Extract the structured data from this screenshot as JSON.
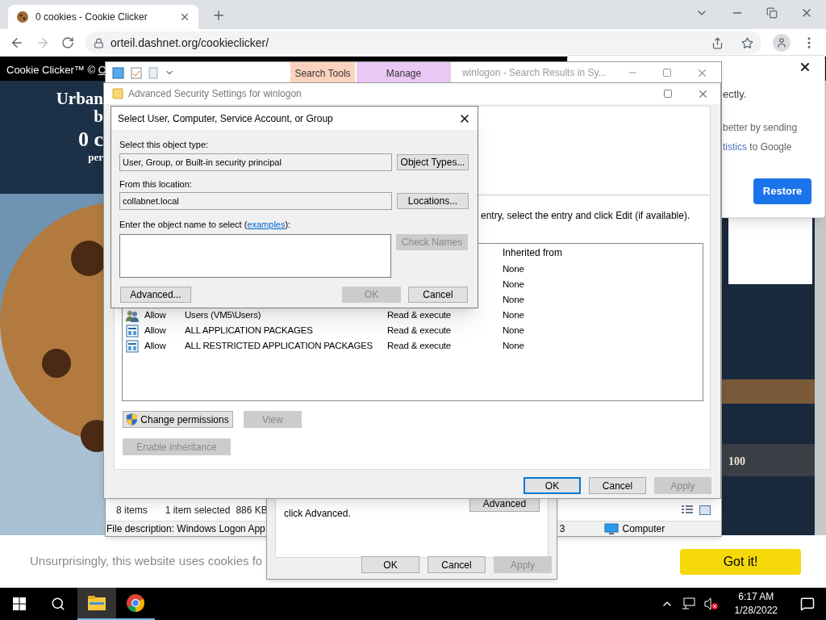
{
  "browser": {
    "tab_title": "0 cookies - Cookie Clicker",
    "url": "orteil.dashnet.org/cookieclicker/"
  },
  "page": {
    "header": "Cookie Clicker™ ©",
    "header_link": "O",
    "bakery_name": [
      "Urban",
      "b"
    ],
    "cookie_count": "0 c",
    "per_second": "per",
    "right_count": "100",
    "cookie_notice": {
      "text": "Unsurprisingly, this website uses cookies fo",
      "button": "Got it!"
    }
  },
  "chrome_popup": {
    "lines": [
      "ectly.",
      "better by sending"
    ],
    "link": "tistics",
    "link_after": "to Google",
    "button": "Restore"
  },
  "explorer": {
    "ribbon_tabs": [
      {
        "label": "Search Tools",
        "color": "#fbd3bd"
      },
      {
        "label": "Manage",
        "color": "#e9c8f3"
      }
    ],
    "title": "winlogon - Search Results in Sy...",
    "item_count": "8 items",
    "selection": "1 item selected",
    "selection_size": "886 KB",
    "file_description": "File description: Windows Logon App",
    "status_3": "3",
    "location": "Computer"
  },
  "properties": {
    "text": "click Advanced.",
    "advanced_button": "Advanced",
    "buttons": [
      {
        "label": "OK",
        "disabled": false
      },
      {
        "label": "Cancel",
        "disabled": false
      },
      {
        "label": "Apply",
        "disabled": true
      }
    ]
  },
  "advanced_security": {
    "title": "Advanced Security Settings for winlogon",
    "instruction": "entry, select the entry and click Edit (if available).",
    "columns": [
      "Inherited from"
    ],
    "rows": [
      {
        "inherited": "None"
      },
      {
        "inherited": "None"
      },
      {
        "inherited": "None"
      },
      {
        "kind": "group",
        "type": "Allow",
        "principal": "Users (VM5\\Users)",
        "access": "Read & execute",
        "inherited": "None"
      },
      {
        "kind": "package",
        "type": "Allow",
        "principal": "ALL APPLICATION PACKAGES",
        "access": "Read & execute",
        "inherited": "None"
      },
      {
        "kind": "package",
        "type": "Allow",
        "principal": "ALL RESTRICTED APPLICATION PACKAGES",
        "access": "Read & execute",
        "inherited": "None"
      }
    ],
    "buttons": [
      {
        "label": "Change permissions",
        "disabled": false,
        "kind": "shield"
      },
      {
        "label": "View",
        "disabled": true,
        "kind": "plain"
      }
    ],
    "inheritance_button": {
      "label": "Enable inheritance",
      "disabled": true
    },
    "footer_buttons": [
      {
        "label": "OK",
        "disabled": false,
        "default": true
      },
      {
        "label": "Cancel",
        "disabled": false,
        "default": false
      },
      {
        "label": "Apply",
        "disabled": true,
        "default": false
      }
    ]
  },
  "select_dialog": {
    "title": "Select User, Computer, Service Account, or Group",
    "object_type_label": "Select this object type:",
    "object_type": "User, Group, or Built-in security principal",
    "object_types_button": "Object Types...",
    "location_label": "From this location:",
    "location": "collabnet.local",
    "locations_button": "Locations...",
    "name_label": "Enter the object name to select (",
    "name_link": "examples",
    "name_label_end": "):",
    "check_names": {
      "label": "Check Names",
      "disabled": true
    },
    "buttons": [
      {
        "label": "Advanced...",
        "disabled": false
      },
      {
        "label": "OK",
        "disabled": true
      },
      {
        "label": "Cancel",
        "disabled": false
      }
    ]
  },
  "taskbar": {
    "apps": [
      {
        "kind": "explorer",
        "selected": true
      },
      {
        "kind": "chrome",
        "selected": false
      }
    ],
    "time": "6:17 AM",
    "date": "1/28/2022",
    "volume_muted": true
  }
}
